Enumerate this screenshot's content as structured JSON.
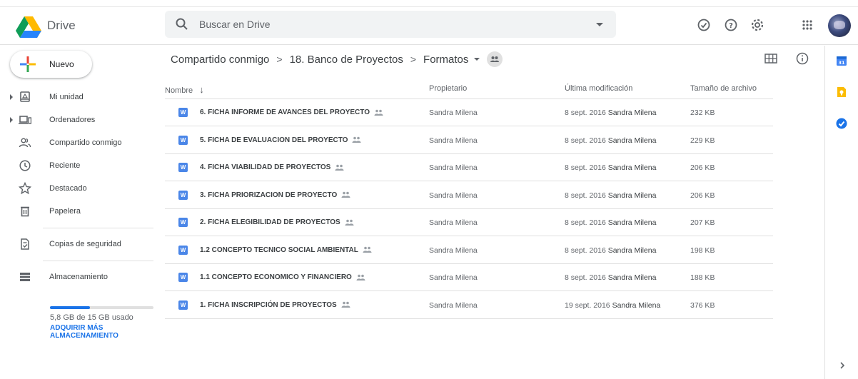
{
  "header": {
    "app_name": "Drive",
    "search_placeholder": "Buscar en Drive",
    "icons": [
      "google-drive-logo-icon",
      "search-icon",
      "dropdown-caret-icon",
      "offline-check-icon",
      "help-icon",
      "settings-gear-icon",
      "apps-grid-icon",
      "account-avatar"
    ]
  },
  "sidebar": {
    "new_label": "Nuevo",
    "items": [
      {
        "label": "Mi unidad",
        "icon": "drive-folder-icon",
        "expandable": true
      },
      {
        "label": "Ordenadores",
        "icon": "computer-icon",
        "expandable": true
      },
      {
        "label": "Compartido conmigo",
        "icon": "shared-people-icon",
        "expandable": false
      },
      {
        "label": "Reciente",
        "icon": "clock-icon",
        "expandable": false
      },
      {
        "label": "Destacado",
        "icon": "star-icon",
        "expandable": false
      },
      {
        "label": "Papelera",
        "icon": "trash-icon",
        "expandable": false
      },
      {
        "label": "Copias de seguridad",
        "icon": "backup-icon",
        "expandable": false
      },
      {
        "label": "Almacenamiento",
        "icon": "storage-icon",
        "expandable": false
      }
    ],
    "storage": {
      "used_text": "5,8 GB de 15 GB usado",
      "used_fraction": 0.387,
      "buy_more": "ADQUIRIR MÁS ALMACENAMIENTO"
    }
  },
  "breadcrumb": {
    "items": [
      "Compartido conmigo",
      "18. Banco de Proyectos",
      "Formatos"
    ],
    "separator": ">"
  },
  "table": {
    "headers": {
      "name": "Nombre",
      "sort_arrow": "↓",
      "owner": "Propietario",
      "modified": "Última modificación",
      "size": "Tamaño de archivo"
    },
    "rows": [
      {
        "name": "6. FICHA INFORME DE AVANCES DEL PROYECTO",
        "owner": "Sandra Milena",
        "date": "8 sept. 2016",
        "modifier": "Sandra Milena",
        "size": "232 KB"
      },
      {
        "name": "5. FICHA DE EVALUACION DEL PROYECTO",
        "owner": "Sandra Milena",
        "date": "8 sept. 2016",
        "modifier": "Sandra Milena",
        "size": "229 KB"
      },
      {
        "name": "4. FICHA VIABILIDAD DE PROYECTOS",
        "owner": "Sandra Milena",
        "date": "8 sept. 2016",
        "modifier": "Sandra Milena",
        "size": "206 KB"
      },
      {
        "name": "3. FICHA PRIORIZACION DE PROYECTO",
        "owner": "Sandra Milena",
        "date": "8 sept. 2016",
        "modifier": "Sandra Milena",
        "size": "206 KB"
      },
      {
        "name": "2. FICHA ELEGIBILIDAD DE PROYECTOS",
        "owner": "Sandra Milena",
        "date": "8 sept. 2016",
        "modifier": "Sandra Milena",
        "size": "207 KB"
      },
      {
        "name": "1.2 CONCEPTO TECNICO SOCIAL AMBIENTAL",
        "owner": "Sandra Milena",
        "date": "8 sept. 2016",
        "modifier": "Sandra Milena",
        "size": "198 KB"
      },
      {
        "name": "1.1 CONCEPTO ECONOMICO Y FINANCIERO",
        "owner": "Sandra Milena",
        "date": "8 sept. 2016",
        "modifier": "Sandra Milena",
        "size": "188 KB"
      },
      {
        "name": "1. FICHA INSCRIPCIÓN DE PROYECTOS",
        "owner": "Sandra Milena",
        "date": "19 sept. 2016",
        "modifier": "Sandra Milena",
        "size": "376 KB"
      }
    ],
    "file_icon_letter": "W"
  },
  "colors": {
    "accent": "#1a73e8",
    "word_icon": "#4a86e8"
  }
}
